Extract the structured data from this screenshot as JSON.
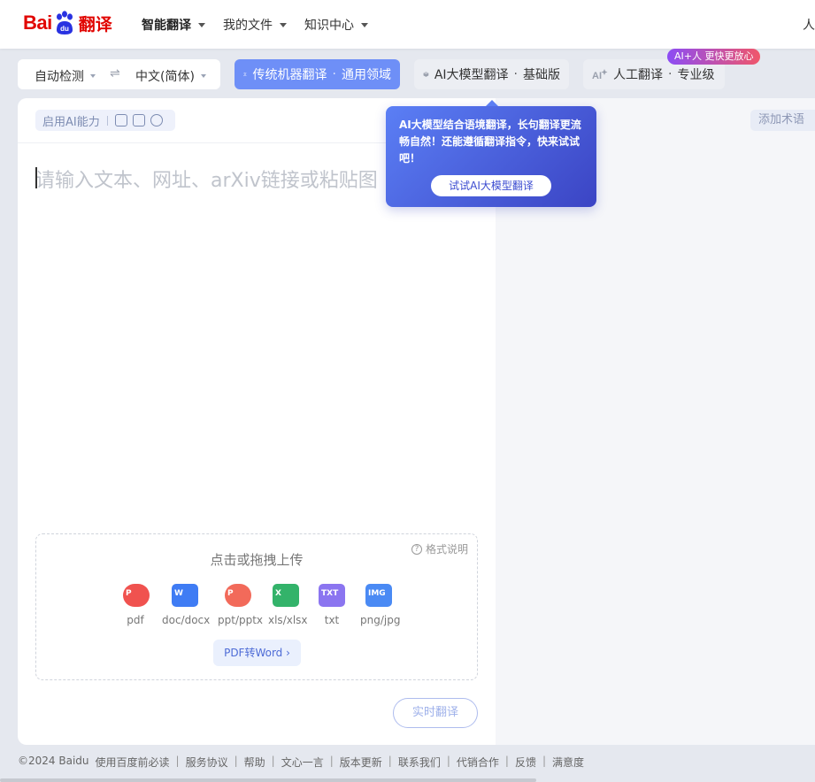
{
  "header": {
    "logo_bai": "Bai",
    "logo_du": "du",
    "logo_fanyi": "翻译",
    "nav": [
      {
        "label": "智能翻译",
        "active": true
      },
      {
        "label": "我的文件",
        "active": false
      },
      {
        "label": "知识中心",
        "active": false
      }
    ],
    "edge_glyph": "人"
  },
  "lang": {
    "source": "自动检测",
    "swap": "⇌",
    "target": "中文(简体)"
  },
  "modes": {
    "machine": {
      "label": "传统机器翻译",
      "sep": "·",
      "sub": "通用领域"
    },
    "llm": {
      "label": "AI大模型翻译",
      "sep": "·",
      "sub": "基础版"
    },
    "human": {
      "label": "人工翻译",
      "sep": "·",
      "sub": "专业级"
    },
    "aiplus_badge": "AI+人 更快更放心"
  },
  "editor": {
    "ai_ability_label": "启用AI能力",
    "add_term": "添加术语",
    "placeholder": "请输入文本、网址、arXiv链接或粘贴图"
  },
  "tooltip": {
    "text": "AI大模型结合语境翻译，长句翻译更流畅自然！还能遵循翻译指令，快来试试吧！",
    "button": "试试AI大模型翻译"
  },
  "upload": {
    "title": "点击或拖拽上传",
    "format_help": "格式说明",
    "types": [
      {
        "label": "pdf",
        "icon": "pdf-file-icon",
        "color": "#f0524f"
      },
      {
        "label": "doc/docx",
        "icon": "word-file-icon",
        "color": "#3f7cf4"
      },
      {
        "label": "ppt/pptx",
        "icon": "ppt-file-icon",
        "color": "#f26a5a"
      },
      {
        "label": "xls/xlsx",
        "icon": "excel-file-icon",
        "color": "#33b36a"
      },
      {
        "label": "txt",
        "icon": "txt-file-icon",
        "color": "#8b75f0"
      },
      {
        "label": "png/jpg",
        "icon": "image-file-icon",
        "color": "#4a8af4"
      }
    ],
    "pdf_to_word": "PDF转Word ›"
  },
  "realtime_button": "实时翻译",
  "footer": {
    "copyright": "©2024 Baidu",
    "links": [
      "使用百度前必读",
      "服务协议",
      "帮助",
      "文心一言",
      "版本更新",
      "联系我们",
      "代销合作",
      "反馈",
      "满意度"
    ]
  }
}
